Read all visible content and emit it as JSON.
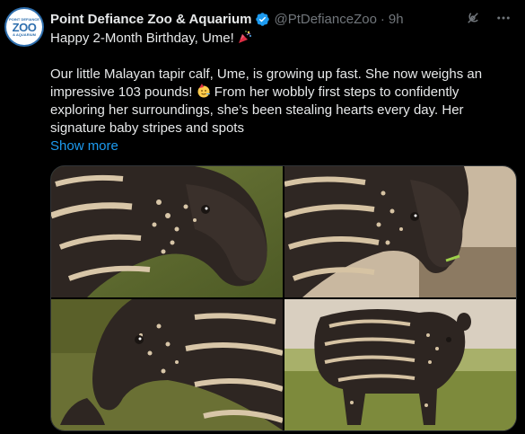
{
  "account": {
    "name": "Point Defiance Zoo & Aquarium",
    "handle": "@PtDefianceZoo",
    "separator": "·",
    "time": "9h",
    "avatar_top": "POINT DEFIANCE",
    "avatar_main": "ZOO",
    "avatar_bottom": "& AQUARIUM"
  },
  "tweet": {
    "line1": "Happy 2-Month Birthday, Ume!",
    "para_part1": "Our little Malayan tapir calf, Ume, is growing up fast. She now weighs an impressive 103 pounds!",
    "para_part2": "From her wobbly first steps to confidently exploring her surroundings, she’s been stealing hearts every day. Her signature baby stripes and spots",
    "show_more": "Show more"
  },
  "icons": {
    "verified": "verified-badge-icon",
    "grok": "grok-icon",
    "more": "more-icon",
    "party": "party-popper-emoji",
    "smile": "partying-face-emoji"
  },
  "colors": {
    "background": "#000000",
    "text": "#e7e9ea",
    "muted": "#71767b",
    "link": "#1d9bf0",
    "verified": "#1d9bf0"
  },
  "media": {
    "photos": [
      "tapir-calf-photo-1",
      "tapir-calf-photo-2",
      "tapir-calf-photo-3",
      "tapir-calf-photo-4"
    ]
  }
}
